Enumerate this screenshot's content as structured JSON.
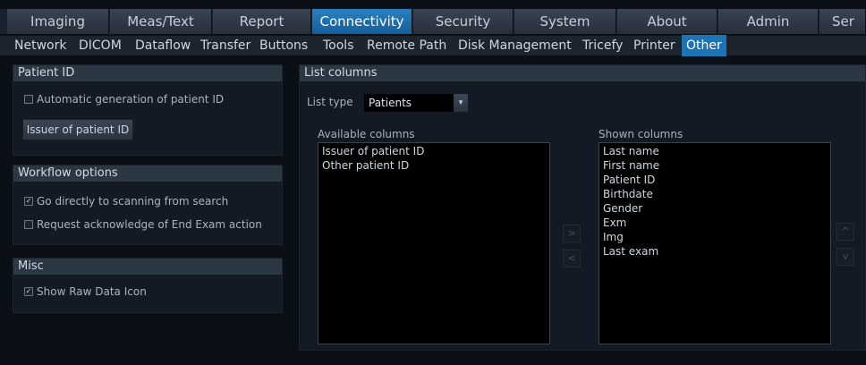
{
  "top_tabs": [
    {
      "label": "Imaging"
    },
    {
      "label": "Meas/Text"
    },
    {
      "label": "Report"
    },
    {
      "label": "Connectivity"
    },
    {
      "label": "Security"
    },
    {
      "label": "System"
    },
    {
      "label": "About"
    },
    {
      "label": "Admin"
    },
    {
      "label": "Ser"
    }
  ],
  "sub_tabs": [
    {
      "label": "Network"
    },
    {
      "label": "DICOM"
    },
    {
      "label": "Dataflow"
    },
    {
      "label": "Transfer"
    },
    {
      "label": "Buttons"
    },
    {
      "label": "Tools"
    },
    {
      "label": "Remote Path"
    },
    {
      "label": "Disk Management"
    },
    {
      "label": "Tricefy"
    },
    {
      "label": "Printer"
    },
    {
      "label": "Other"
    }
  ],
  "patient_id": {
    "title": "Patient ID",
    "auto_gen_label": "Automatic generation of patient ID",
    "auto_gen_checked": false,
    "issuer_button": "Issuer of patient ID"
  },
  "workflow": {
    "title": "Workflow options",
    "go_scan_label": "Go directly to scanning from search",
    "go_scan_checked": true,
    "ack_label": "Request acknowledge of End Exam action",
    "ack_checked": false
  },
  "misc": {
    "title": "Misc",
    "raw_icon_label": "Show Raw Data Icon",
    "raw_icon_checked": true
  },
  "list_columns": {
    "title": "List columns",
    "list_type_label": "List type",
    "list_type_value": "Patients",
    "available_label": "Available columns",
    "available": [
      "Issuer of patient ID",
      "Other patient ID"
    ],
    "shown_label": "Shown columns",
    "shown": [
      "Last name",
      "First name",
      "Patient ID",
      "Birthdate",
      "Gender",
      "Exm",
      "Img",
      "Last exam"
    ]
  }
}
